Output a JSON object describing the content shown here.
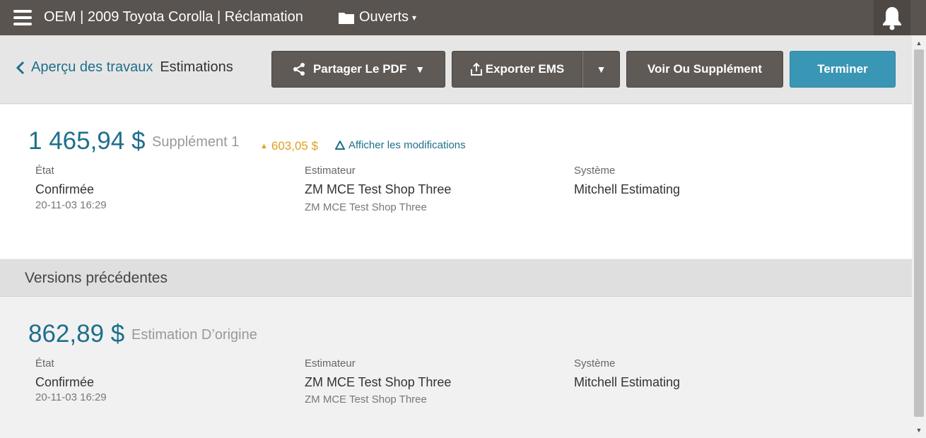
{
  "topbar": {
    "title": "OEM | 2009 Toyota Corolla | Réclamation",
    "folder_label": "Ouverts",
    "folder_caret": "▾"
  },
  "header": {
    "back_label": "Aperçu des travaux",
    "current_label": "Estimations",
    "share_label": "Partager Le PDF",
    "export_label": "Exporter EMS",
    "view_supplement_label": "Voir Ou Supplément",
    "finish_label": "Terminer",
    "dropdown_glyph": "▼"
  },
  "current_estimate": {
    "amount": "1 465,94 $",
    "label": "Supplément 1",
    "delta": "603,05 $",
    "delta_glyph": "▲",
    "show_changes": "Afficher les modifications",
    "state_label": "État",
    "state_value": "Confirmée",
    "state_date": "20-11-03 16:29",
    "estimator_label": "Estimateur",
    "estimator_value": "ZM MCE Test Shop Three",
    "estimator_sub": "ZM MCE Test Shop Three",
    "system_label": "Système",
    "system_value": "Mitchell Estimating"
  },
  "previous_section": {
    "title": "Versions précédentes"
  },
  "previous_estimate": {
    "amount": "862,89 $",
    "label": "Estimation D’origine",
    "state_label": "État",
    "state_value": "Confirmée",
    "state_date": "20-11-03 16:29",
    "estimator_label": "Estimateur",
    "estimator_value": "ZM MCE Test Shop Three",
    "estimator_sub": "ZM MCE Test Shop Three",
    "system_label": "Système",
    "system_value": "Mitchell Estimating"
  },
  "scrollbar": {
    "up_glyph": "▲",
    "down_glyph": "▼"
  },
  "colors": {
    "topbar": "#595450",
    "accent": "#1e6f8c",
    "primary_button": "#3a96b5",
    "dark_button": "#5f5a56",
    "delta": "#e0a020"
  }
}
